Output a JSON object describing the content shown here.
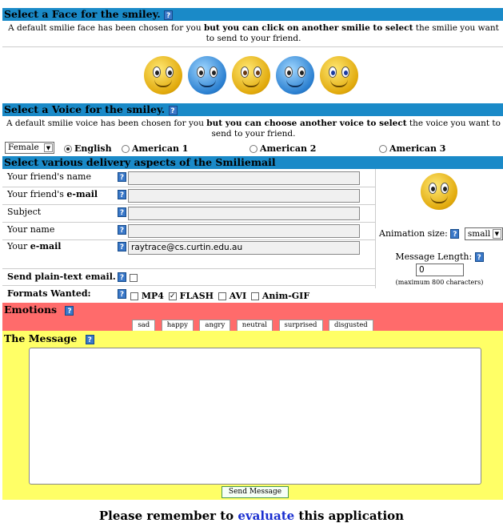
{
  "face_section": {
    "title": "Select a Face for the smiley.",
    "desc_part1": "A default smilie face has been chosen for you ",
    "desc_bold": "but you can click on another smilie to select",
    "desc_part2": " the smilie you want to send to your friend.",
    "faces": [
      "yellow",
      "blue",
      "yellow",
      "blue",
      "yellow"
    ]
  },
  "voice_section": {
    "title": "Select a Voice for the smiley.",
    "desc_part1": "A default smilie voice has been chosen for you ",
    "desc_bold": "but you can choose another voice to select",
    "desc_part2": " the voice you want to send to your friend.",
    "gender_selected": "Female",
    "voices": [
      "English",
      "American 1",
      "American 2",
      "American 3"
    ],
    "selected_voice": "English"
  },
  "delivery_section": {
    "title": "Select various delivery aspects of the Smiliemail",
    "friend_name_label": "Your friend's name",
    "friend_email_label_a": "Your friend's ",
    "friend_email_label_b": "e-mail",
    "subject_label": "Subject",
    "your_name_label": "Your name",
    "your_email_label_a": "Your ",
    "your_email_label_b": "e-mail",
    "your_email_value": "raytrace@cs.curtin.edu.au",
    "plain_text_label": "Send plain-text email.",
    "formats_label": "Formats Wanted:",
    "formats": [
      {
        "label": "MP4",
        "checked": false
      },
      {
        "label": "FLASH",
        "checked": true
      },
      {
        "label": "AVI",
        "checked": false
      },
      {
        "label": "Anim-GIF",
        "checked": false
      }
    ],
    "animation_size_label": "Animation size:",
    "animation_size_value": "small",
    "message_length_label": "Message Length:",
    "message_length_value": "0",
    "max_chars_note": "(maximum 800 characters)"
  },
  "emotions_section": {
    "title": "Emotions",
    "buttons": [
      "sad",
      "happy",
      "angry",
      "neutral",
      "surprised",
      "disgusted"
    ]
  },
  "message_section": {
    "title": "The Message",
    "send_label": "Send Message"
  },
  "footer": {
    "text_a": "Please remember to ",
    "link": "evaluate",
    "text_b": " this application"
  },
  "colors": {
    "section_blue": "#1a8ac8",
    "emotions_red": "#ff6b6b",
    "message_yellow": "#ffff66"
  }
}
